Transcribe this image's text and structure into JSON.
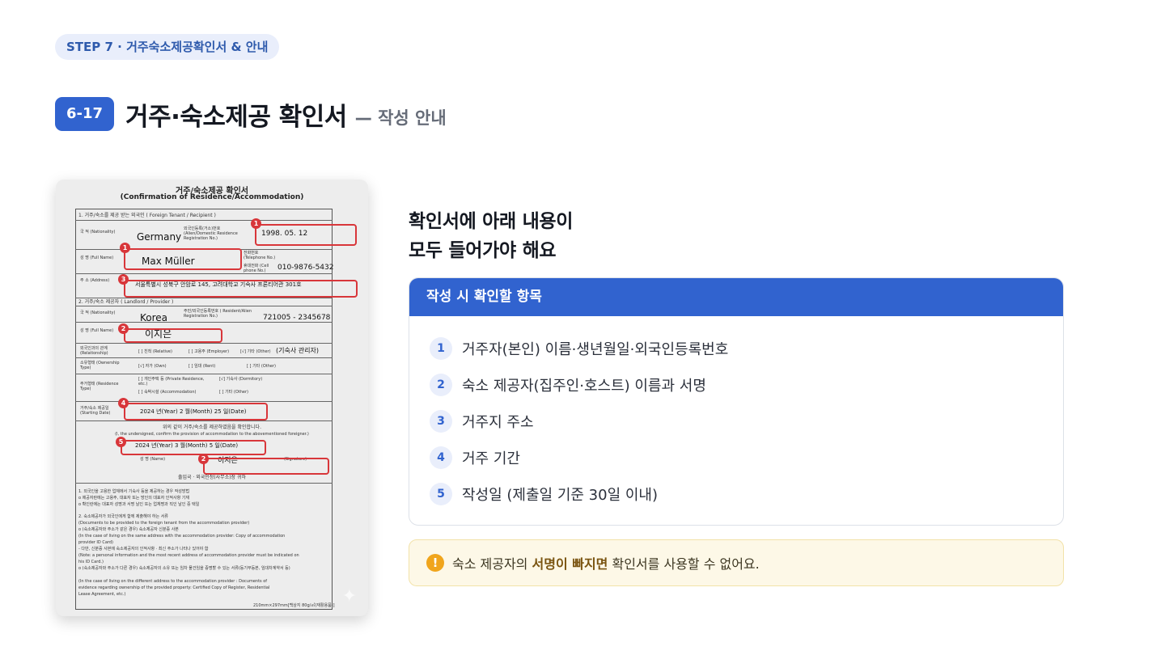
{
  "step_label": "STEP 7 · 거주숙소제공확인서 & 안내",
  "section_number": "6-17",
  "title": "거주·숙소제공 확인서",
  "subtitle": "— 작성 안내",
  "document": {
    "title_ko": "거주/숙소제공 확인서",
    "title_en": "(Confirmation of Residence/Accommodation)",
    "sec1": "1. 거주/숙소를 제공 받는 외국인 ( Foreign Tenant / Recipient )",
    "nationality_label": "국 적 (Nationality)",
    "nationality": "Germany",
    "reg_label": "외국인등록(거소)번호 (Alien/Domestic Residence Registration No.)",
    "birth": "1998. 05. 12",
    "name_label": "성 명 (Full Name)",
    "name": "Max Müller",
    "tel_label": "전화번호 (Telephone No.)",
    "cell_label": "휴대전화 (Cell phone No.)",
    "phone": "010-9876-5432",
    "address_label": "주 소 (Address)",
    "address": "서울특별시 성북구 안암로 145, 고려대학교 기숙사 프론티어관 301호",
    "sec2": "2. 거주/숙소 제공자 ( Landlord / Provider )",
    "p_nationality": "Korea",
    "p_reg_label": "주민/외국인등록번호 ( Resident/Alien Registration No.)",
    "p_reg": "721005 - 2345678",
    "p_name": "이지은",
    "relationship_label": "외국인과의 관계 (Relationship)",
    "rel_relative": "[ ] 친척 (Relative)",
    "rel_employer": "[ ] 고용주 (Employer)",
    "rel_other": "[√] 기타 (Other)",
    "rel_other_value": "(기숙사 관리자)",
    "ownership_label": "소유형태 (Ownership Type)",
    "own_own": "[√] 자가 (Own)",
    "own_rent": "[ ] 임대 (Rent)",
    "own_other": "[ ] 기타 (Other)",
    "residence_label": "주거형태 (Residence Type)",
    "res_private": "[ ] 개인주택 등 (Private Residence, etc.)",
    "res_dorm": "[√] 기숙사 (Dormitory)",
    "res_accom": "[ ] 숙박시설 (Accommodation)",
    "res_other": "[ ] 기타 (Other)",
    "start_label": "거주/숙소 제공일 (Starting Date)",
    "start_date": "2024 년(Year) 2 월(Month) 25 일(Date)",
    "confirm_ko": "위의 같이 거주/숙소를 제공하였음을 확인합니다.",
    "confirm_en": "(I, the undersigned, confirm the provision of accommodation to the abovementioned foreigner.)",
    "written_date": "2024 년(Year) 3 월(Month) 5 일(Date)",
    "sign_label": "성 명 (Name)",
    "sign_name": "이지은",
    "signature_label": "(Signature)",
    "addressee": "출입국 · 외국인청(사무소)장 귀하",
    "note1": "1. 외국인을 고용한 업체에서 기숙사 등을 제공하는 경우 작성방법",
    "note1a": "o 제공자란에는 고용주, 대표자 또는 방인의 대표자 인적사항 기재",
    "note1b": "o 확인란에는 대표자 성명과 서명 날인 또는 업체명과 직인 날인 중 택일",
    "note2": "2. 숙소제공자가 외국인에게 함께 제출해야 하는 서류",
    "note2a": "(Documents to be provided to the foreign tenant from the accommodation provider)",
    "note2b": "o (숙소제공자와 주소가 같은 경우) 숙소제공자 신분증 사본",
    "note2c": "(In the case of living on the same address with the accommodation provider: Copy of accommodation",
    "note2d": "provider ID Card)",
    "note2e": "- 다만, 신분증 사본에 숙소제공자의 인적사항 · 최신 주소가 나타나 있어야 함",
    "note2f": "(Note: a personal information and the most recent address of accommodation provider must be indicated on",
    "note2g": "his ID Card.)",
    "note2h": "o (숙소제공자와 주소가 다른 경우) 숙소제공자의 소유 또는 임차 물건임을 증명할 수 있는 서류(등기부등본, 임대차계약서 등)",
    "note2i": "(In the case of living on the different address to the accommodation provider : Documents of",
    "note2j": "evidence regarding ownership of the provided property: Certified Copy of Register, Residential",
    "note2k": "Lease Agreement, etc.)",
    "paper": "210mm×297mm[백상지 80g/㎡(재활용품)]",
    "markers": [
      "1",
      "1",
      "3",
      "2",
      "4",
      "5",
      "2"
    ]
  },
  "right_heading_1": "확인서에 아래 내용이",
  "right_heading_2": "모두 들어가야 해요",
  "checklist": {
    "title": "작성 시 확인할 항목",
    "items": [
      {
        "num": "1",
        "text": "거주자(본인) 이름·생년월일·외국인등록번호"
      },
      {
        "num": "2",
        "text": "숙소 제공자(집주인·호스트) 이름과 서명"
      },
      {
        "num": "3",
        "text": "거주지 주소"
      },
      {
        "num": "4",
        "text": "거주 기간"
      },
      {
        "num": "5",
        "text": "작성일 (제출일 기준 30일 이내)"
      }
    ]
  },
  "warning": {
    "icon": "!",
    "pre": "숙소 제공자의 ",
    "bold": "서명이 빠지면",
    "post": " 확인서를 사용할 수 없어요."
  },
  "colors": {
    "accent": "#3163cf",
    "marker": "#d8363a",
    "warning": "#f0a51c"
  }
}
